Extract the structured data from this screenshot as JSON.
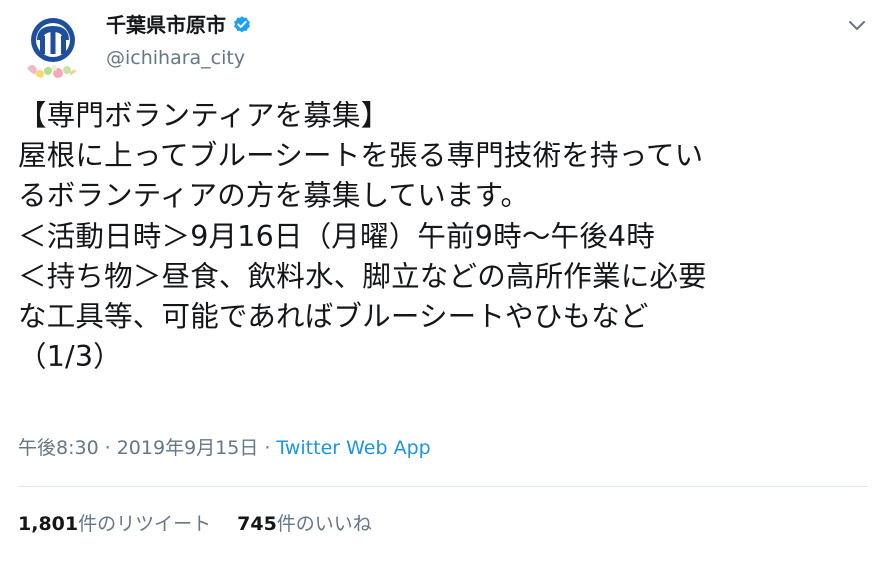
{
  "user": {
    "display_name": "千葉県市原市",
    "handle": "@ichihara_city",
    "verified": true
  },
  "tweet": {
    "lines": [
      "【専門ボランティアを募集】",
      "屋根に上ってブルーシートを張る専門技術を持ってい",
      "るボランティアの方を募集しています。",
      "＜活動日時＞9月16日（月曜）午前9時～午後4時",
      "＜持ち物＞昼食、飲料水、脚立などの高所作業に必要",
      "な工具等、可能であればブルーシートやひもなど",
      "（1/3）"
    ]
  },
  "meta": {
    "time": "午後8:30",
    "separator": "·",
    "date": "2019年9月15日",
    "source": "Twitter Web App"
  },
  "stats": {
    "retweets_count": "1,801",
    "retweets_label": "件のリツイート",
    "likes_count": "745",
    "likes_label": "件のいいね"
  },
  "colors": {
    "accent": "#1b95e0",
    "secondary_text": "#657786",
    "emblem_blue": "#1d4f9c"
  },
  "icons": {
    "avatar": "ichihara-city-emblem",
    "verified": "verified-badge-icon",
    "menu": "chevron-down-icon"
  }
}
